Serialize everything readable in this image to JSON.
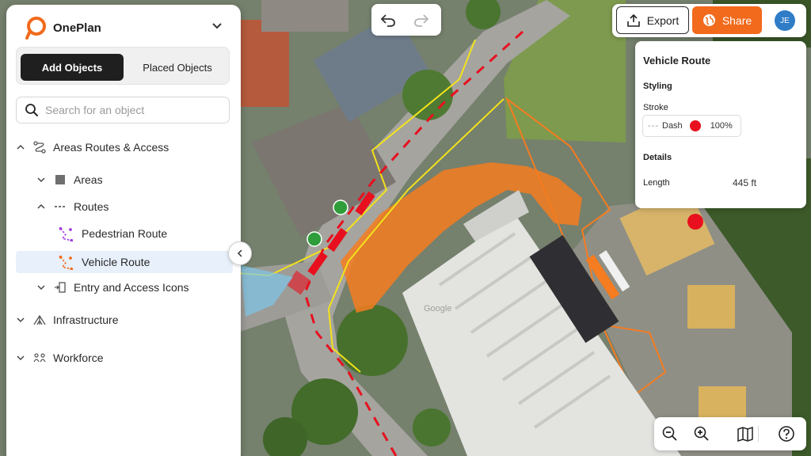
{
  "app": {
    "name": "OnePlan"
  },
  "sidebar": {
    "tabs": [
      {
        "label": "Add Objects",
        "active": true
      },
      {
        "label": "Placed Objects",
        "active": false
      }
    ],
    "search": {
      "placeholder": "Search for an object",
      "value": ""
    },
    "tree": [
      {
        "label": "Areas Routes & Access",
        "icon": "route-icon",
        "expanded": true
      },
      {
        "label": "Areas",
        "icon": "square-icon",
        "expanded": false
      },
      {
        "label": "Routes",
        "icon": "dashed-line-icon",
        "expanded": true
      },
      {
        "label": "Pedestrian Route",
        "icon": "pedestrian-route-icon"
      },
      {
        "label": "Vehicle Route",
        "icon": "vehicle-route-icon",
        "selected": true
      },
      {
        "label": "Entry and Access Icons",
        "icon": "entry-access-icon",
        "expanded": false
      },
      {
        "label": "Infrastructure",
        "icon": "tent-icon",
        "expanded": false
      },
      {
        "label": "Workforce",
        "icon": "people-icon",
        "expanded": false
      }
    ]
  },
  "toolbar": {
    "export_label": "Export",
    "share_label": "Share",
    "avatar_initials": "JE"
  },
  "properties": {
    "title": "Vehicle Route",
    "styling_label": "Styling",
    "stroke_label": "Stroke",
    "stroke_dash_glyph": "---",
    "stroke_style": "Dash",
    "stroke_color": "#e8101e",
    "stroke_opacity": "100%",
    "details_label": "Details",
    "length_label": "Length",
    "length_value": "445 ft"
  },
  "map": {
    "watermark": "Google",
    "route_color": "#e8101e",
    "area_color": "#f57c20"
  },
  "colors": {
    "accent": "#f26a1b",
    "selected_bg": "#e8f0fb",
    "avatar": "#2f7cc7"
  }
}
